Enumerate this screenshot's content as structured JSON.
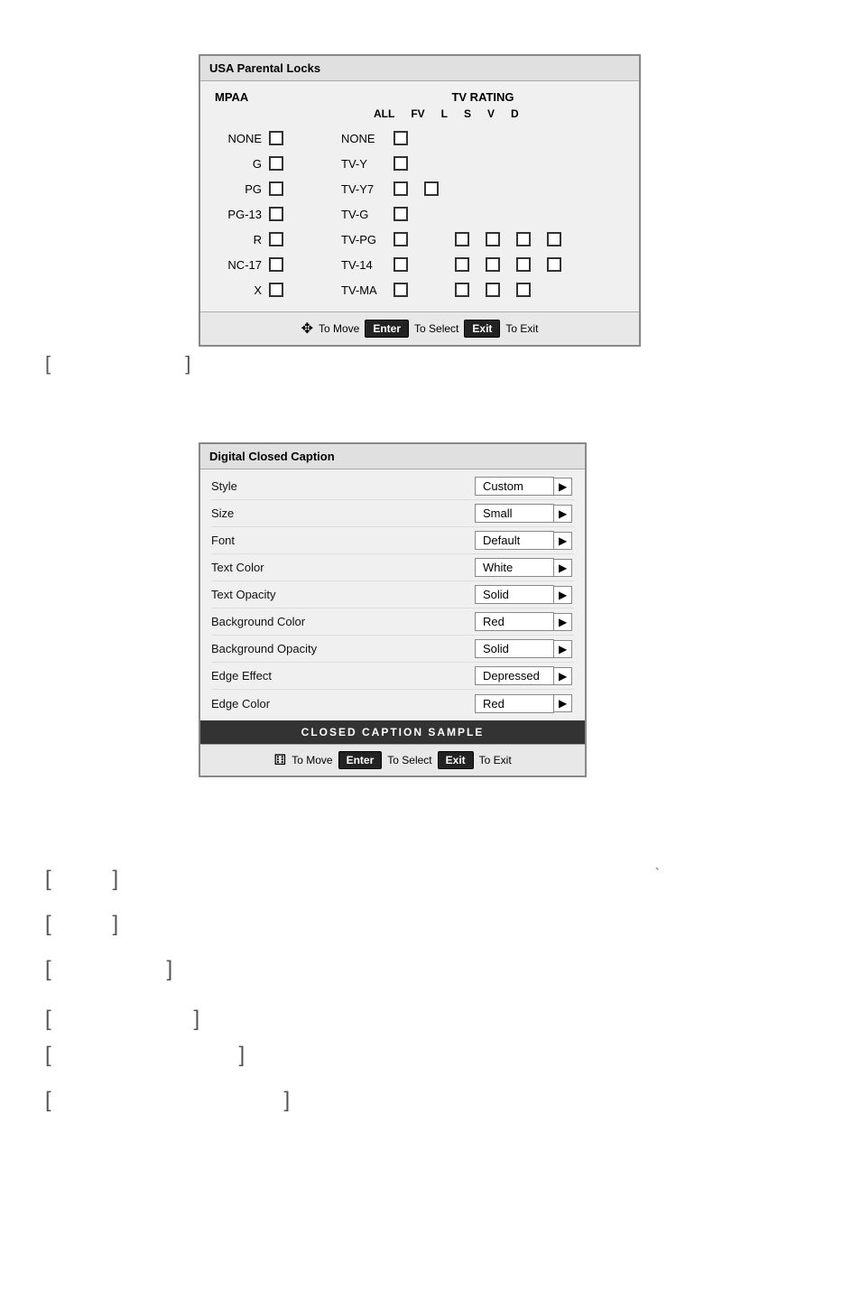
{
  "parental_locks": {
    "title": "USA Parental Locks",
    "mpaa_header": "MPAA",
    "tv_rating_header": "TV RATING",
    "tv_rating_sub": [
      "ALL",
      "FV",
      "L",
      "S",
      "V",
      "D"
    ],
    "mpaa_rows": [
      "NONE",
      "G",
      "PG",
      "PG-13",
      "R",
      "NC-17",
      "X"
    ],
    "tv_rows": [
      "NONE",
      "TV-Y",
      "TV-Y7",
      "TV-G",
      "TV-PG",
      "TV-14",
      "TV-MA"
    ],
    "footer_move": "To Move",
    "footer_enter": "Enter",
    "footer_select": "To Select",
    "footer_exit": "Exit",
    "footer_exit2": "To Exit"
  },
  "bracket1": {
    "open": "[",
    "close": "]"
  },
  "dcc": {
    "title": "Digital Closed Caption",
    "rows": [
      {
        "label": "Style",
        "value": "Custom"
      },
      {
        "label": "Size",
        "value": "Small"
      },
      {
        "label": "Font",
        "value": "Default"
      },
      {
        "label": "Text Color",
        "value": "White"
      },
      {
        "label": "Text Opacity",
        "value": "Solid"
      },
      {
        "label": "Background Color",
        "value": "Red"
      },
      {
        "label": "Background Opacity",
        "value": "Solid"
      },
      {
        "label": "Edge Effect",
        "value": "Depressed"
      },
      {
        "label": "Edge Color",
        "value": "Red"
      }
    ],
    "sample_label": "CLOSED CAPTION SAMPLE",
    "footer_move": "To Move",
    "footer_enter": "Enter",
    "footer_select": "To Select",
    "footer_exit": "Exit",
    "footer_exit2": "To Exit"
  },
  "bottom_brackets": [
    {
      "open": "[",
      "close": "]",
      "extra": "`"
    },
    {
      "open": "[",
      "close": "]"
    },
    {
      "open": "[",
      "close": "]",
      "wide": true
    },
    {
      "open": "[",
      "close": "]",
      "wide2": true
    },
    {
      "open": "[",
      "close": "]",
      "wide3": true
    },
    {
      "open": "[",
      "close": "]",
      "wide4": true
    }
  ]
}
